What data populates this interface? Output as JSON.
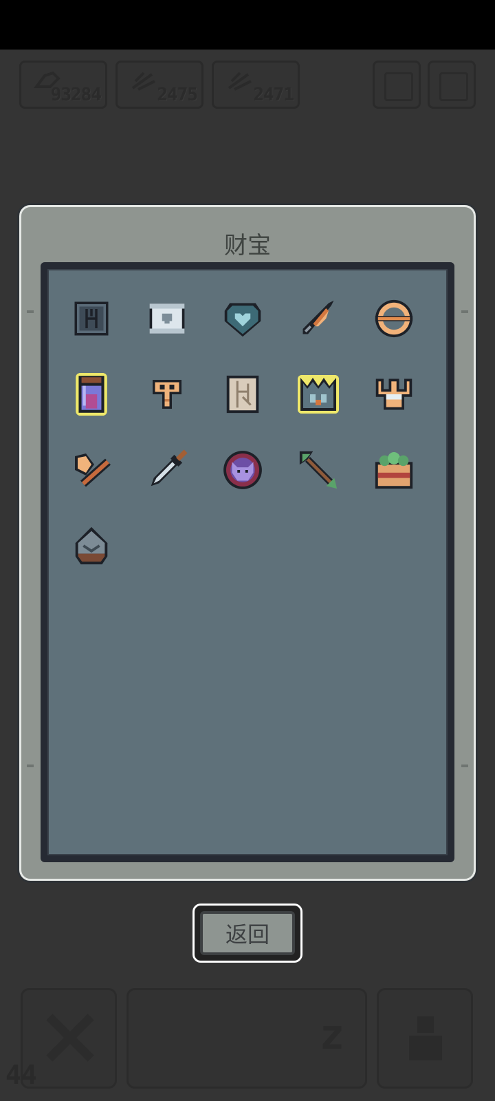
{
  "hud": {
    "resources": [
      {
        "icon": "meat-icon",
        "value": "93284"
      },
      {
        "icon": "wood-icon",
        "value": "2475"
      },
      {
        "icon": "stone-icon",
        "value": "2471"
      }
    ],
    "level": "44"
  },
  "treasure": {
    "title": "财宝",
    "back_label": "返回",
    "items": [
      {
        "name": "rune-tablet-icon",
        "highlighted": false
      },
      {
        "name": "skull-scroll-icon",
        "highlighted": false
      },
      {
        "name": "heart-gem-icon",
        "highlighted": false
      },
      {
        "name": "spear-head-icon",
        "highlighted": false
      },
      {
        "name": "orb-ring-icon",
        "highlighted": false
      },
      {
        "name": "potion-jar-icon",
        "highlighted": true
      },
      {
        "name": "golden-key-icon",
        "highlighted": false
      },
      {
        "name": "ancient-map-icon",
        "highlighted": false
      },
      {
        "name": "crystal-crown-icon",
        "highlighted": true
      },
      {
        "name": "gold-trident-icon",
        "highlighted": false
      },
      {
        "name": "battle-axe-icon",
        "highlighted": false
      },
      {
        "name": "dagger-icon",
        "highlighted": false
      },
      {
        "name": "demon-amulet-icon",
        "highlighted": false
      },
      {
        "name": "jade-arrow-icon",
        "highlighted": false
      },
      {
        "name": "herb-chest-icon",
        "highlighted": false
      },
      {
        "name": "iron-helmet-icon",
        "highlighted": false
      }
    ]
  }
}
